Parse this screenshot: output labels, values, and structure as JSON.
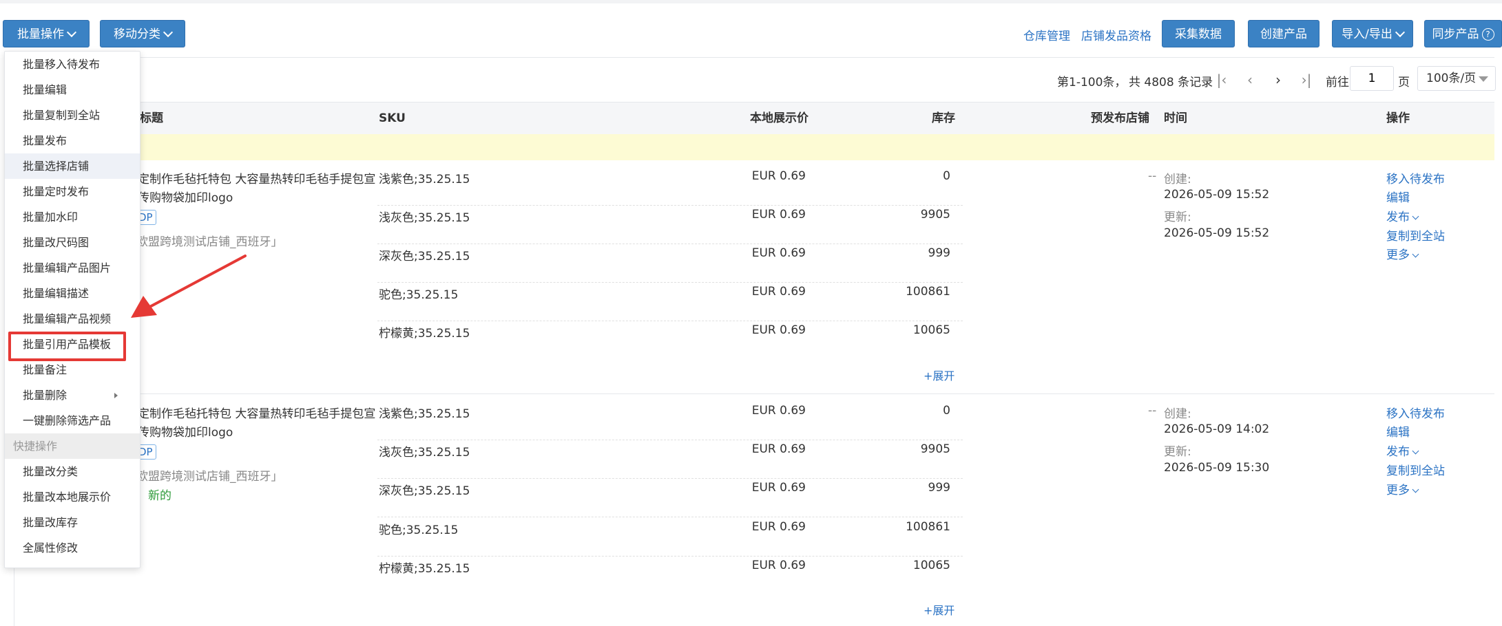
{
  "toolbar": {
    "batch_ops": "批量操作",
    "move_category": "移动分类",
    "warehouse": "仓库管理",
    "store_qual": "店铺发品资格",
    "collect": "采集数据",
    "create": "创建产品",
    "import_export": "导入/导出",
    "sync": "同步产品"
  },
  "pagination": {
    "range": "第1-100条，",
    "total": "共 4808 条记录",
    "goto": "前往",
    "page_value": "1",
    "page_unit": "页",
    "page_size": "100条/页"
  },
  "table": {
    "headers": {
      "title": "标题",
      "sku": "SKU",
      "price": "本地展示价",
      "stock": "库存",
      "pre_store": "预发布店铺",
      "time": "时间",
      "actions": "操作"
    },
    "rows": [
      {
        "title_l1": "定制作毛毡托特包 大容量热转印毛毡手提包宣",
        "title_l2": "传购物袋加印logo",
        "tag": "DP",
        "store": "欧盟跨境测试店铺_西班牙」",
        "status": "",
        "skus": [
          {
            "sku": "浅紫色;35.25.15",
            "price": "EUR 0.69",
            "stock": "0"
          },
          {
            "sku": "浅灰色;35.25.15",
            "price": "EUR 0.69",
            "stock": "9905"
          },
          {
            "sku": "深灰色;35.25.15",
            "price": "EUR 0.69",
            "stock": "999"
          },
          {
            "sku": "驼色;35.25.15",
            "price": "EUR 0.69",
            "stock": "100861"
          },
          {
            "sku": "柠檬黄;35.25.15",
            "price": "EUR 0.69",
            "stock": "10065"
          }
        ],
        "expand": "+展开",
        "pre_store": "--",
        "created_label": "创建:",
        "created": "2026-05-09 15:52",
        "updated_label": "更新:",
        "updated": "2026-05-09 15:52",
        "ops": [
          "移入待发布",
          "编辑",
          "发布",
          "复制到全站",
          "更多"
        ]
      },
      {
        "title_l1": "定制作毛毡托特包 大容量热转印毛毡手提包宣",
        "title_l2": "传购物袋加印logo",
        "tag": "DP",
        "store": "欧盟跨境测试店铺_西班牙」",
        "status": "：新的",
        "skus": [
          {
            "sku": "浅紫色;35.25.15",
            "price": "EUR 0.69",
            "stock": "0"
          },
          {
            "sku": "浅灰色;35.25.15",
            "price": "EUR 0.69",
            "stock": "9905"
          },
          {
            "sku": "深灰色;35.25.15",
            "price": "EUR 0.69",
            "stock": "999"
          },
          {
            "sku": "驼色;35.25.15",
            "price": "EUR 0.69",
            "stock": "100861"
          },
          {
            "sku": "柠檬黄;35.25.15",
            "price": "EUR 0.69",
            "stock": "10065"
          }
        ],
        "expand": "+展开",
        "pre_store": "--",
        "created_label": "创建:",
        "created": "2026-05-09 14:02",
        "updated_label": "更新:",
        "updated": "2026-05-09 15:30",
        "ops": [
          "移入待发布",
          "编辑",
          "发布",
          "复制到全站",
          "更多"
        ]
      }
    ]
  },
  "menu": {
    "items": [
      "批量移入待发布",
      "批量编辑",
      "批量复制到全站",
      "批量发布",
      "批量选择店铺",
      "批量定时发布",
      "批量加水印",
      "批量改尺码图",
      "批量编辑产品图片",
      "批量编辑描述",
      "批量编辑产品视频",
      "批量引用产品模板",
      "批量备注",
      "批量删除",
      "一键删除筛选产品"
    ],
    "group_label": "快捷操作",
    "quick_items": [
      "批量改分类",
      "批量改本地展示价",
      "批量改库存",
      "全属性修改"
    ]
  },
  "colors": {
    "primary": "#3b82c4",
    "link": "#2b73c4",
    "highlight_row": "#fdfbd4",
    "annotation": "#e53935",
    "status_new": "#2e9b3a"
  }
}
